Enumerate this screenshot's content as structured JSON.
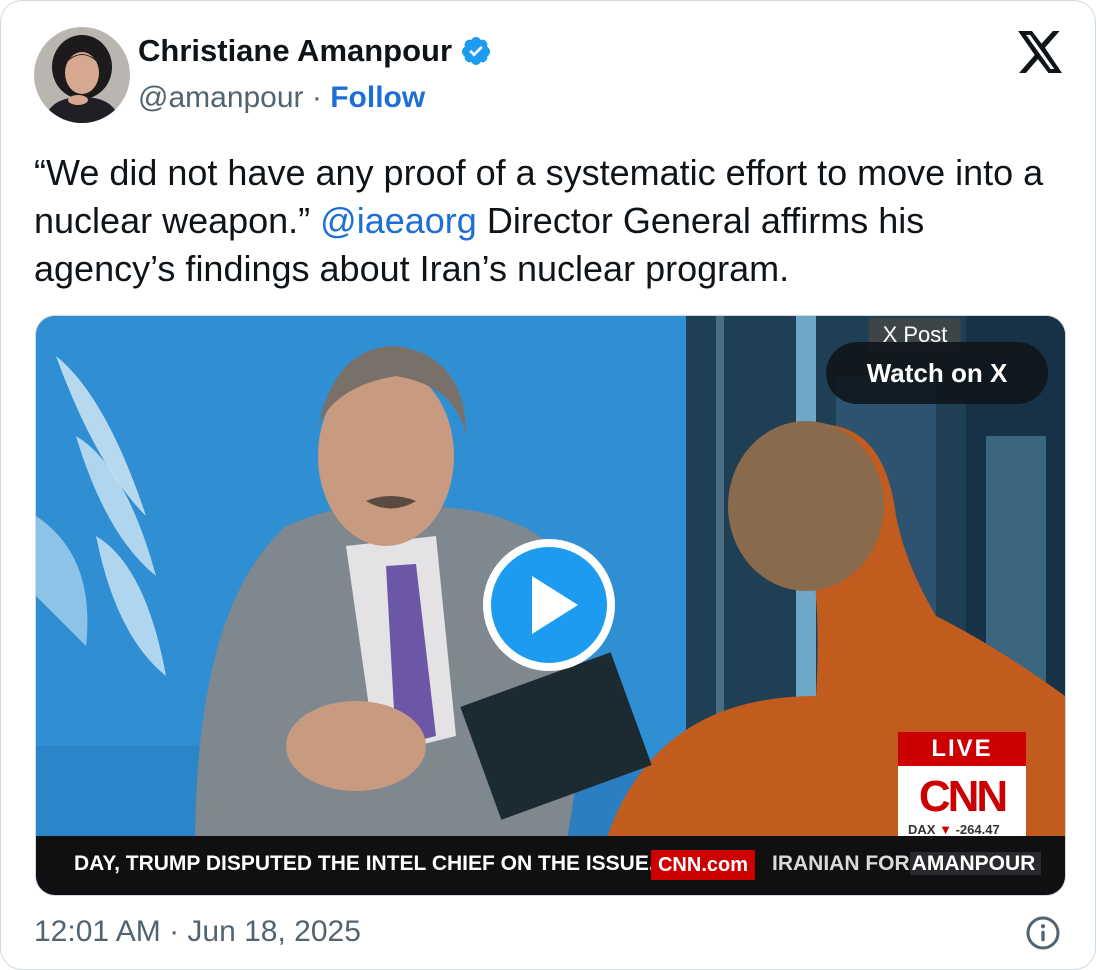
{
  "author": {
    "name": "Christiane Amanpour",
    "handle": "@amanpour",
    "separator": "·",
    "follow_label": "Follow",
    "verified": true
  },
  "tweet": {
    "text_before": "“We did not have any proof of a systematic effort to move into a nuclear weapon.” ",
    "mention": "@iaeaorg",
    "text_after": " Director General affirms his agency’s findings about Iran’s nuclear program."
  },
  "media": {
    "badge_label": "X Post",
    "watch_label": "Watch on X",
    "live_label": "LIVE",
    "network_logo": "CNN",
    "dax_label": "DAX",
    "dax_value": "-264.47",
    "ticker_left": "DAY, TRUMP DISPUTED THE INTEL CHIEF ON THE ISSUE.",
    "ticker_site": "CNN.com",
    "ticker_right_dim": "IRANIAN FOR",
    "ticker_right_bright": "AMANPOUR"
  },
  "footer": {
    "timestamp": "12:01 AM · Jun 18, 2025"
  },
  "icons": [
    "verified-badge-icon",
    "x-logo-icon",
    "play-icon",
    "info-icon"
  ],
  "colors": {
    "link_blue": "#1d6fd6",
    "verified_blue": "#1d9bf0",
    "cnn_red": "#cc0000",
    "secondary_text": "#536471"
  }
}
